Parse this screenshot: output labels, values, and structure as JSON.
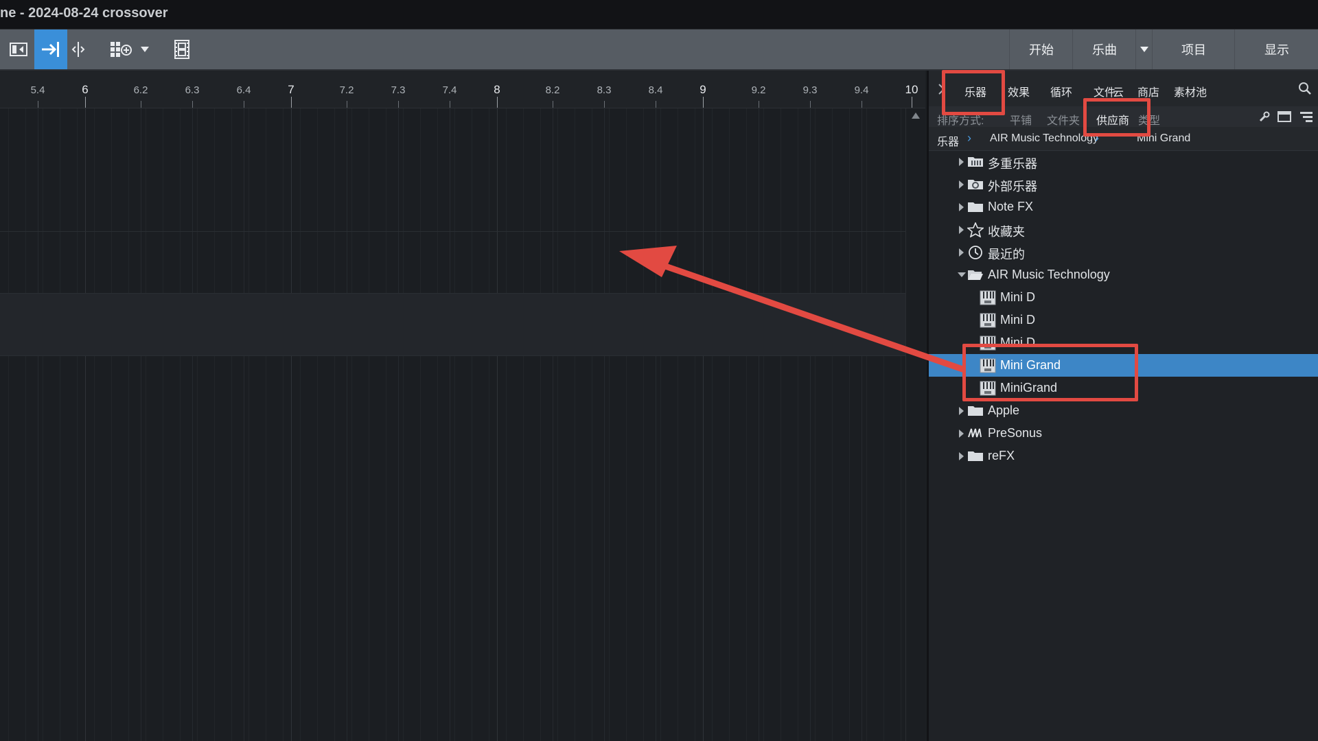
{
  "window": {
    "title": "ne - 2024-08-24 crossover"
  },
  "toolbar": {
    "icons": [
      "show-inspector-icon",
      "snap-arrow-icon",
      "split-icon",
      "grid-add-icon",
      "dropdown-icon",
      "film-strip-icon"
    ],
    "right_buttons": [
      "开始",
      "乐曲",
      "项目",
      "显示"
    ]
  },
  "ruler": {
    "ticks": [
      "5.4",
      "6",
      "6.2",
      "6.3",
      "6.4",
      "7",
      "7.2",
      "7.3",
      "7.4",
      "8",
      "8.2",
      "8.3",
      "8.4",
      "9",
      "9.2",
      "9.3",
      "9.4",
      "10"
    ]
  },
  "browser": {
    "tabs": [
      "乐器",
      "效果",
      "循环",
      "文件",
      "云",
      "商店",
      "素材池"
    ],
    "sort_label": "排序方式:",
    "sort_options": [
      "平铺",
      "文件夹",
      "供应商",
      "类型"
    ],
    "sort_active": "供应商",
    "breadcrumb": [
      "乐器",
      "AIR Music Technology",
      "Mini Grand"
    ],
    "tree": [
      {
        "label": "多重乐器",
        "icon": "multi-instrument-icon",
        "expandable": true
      },
      {
        "label": "外部乐器",
        "icon": "external-instrument-icon",
        "expandable": true
      },
      {
        "label": "Note FX",
        "icon": "folder-icon",
        "expandable": true
      },
      {
        "label": "收藏夹",
        "icon": "star-icon",
        "expandable": true
      },
      {
        "label": "最近的",
        "icon": "clock-icon",
        "expandable": true
      },
      {
        "label": "AIR Music Technology",
        "icon": "open-folder-icon",
        "expandable": true,
        "open": true
      },
      {
        "label": "Mini D",
        "icon": "piano-plugin-icon",
        "child": true
      },
      {
        "label": "Mini D",
        "icon": "piano-plugin-icon",
        "child": true
      },
      {
        "label": "Mini D",
        "icon": "piano-plugin-icon",
        "child": true
      },
      {
        "label": "Mini Grand",
        "icon": "piano-plugin-icon",
        "child": true,
        "selected": true
      },
      {
        "label": "MiniGrand",
        "icon": "piano-au-icon",
        "child": true
      },
      {
        "label": "Apple",
        "icon": "folder-icon",
        "expandable": true
      },
      {
        "label": "PreSonus",
        "icon": "presonus-icon",
        "expandable": true
      },
      {
        "label": "reFX",
        "icon": "folder-icon",
        "expandable": true
      }
    ]
  },
  "annotations": {
    "color": "#e24a42"
  }
}
